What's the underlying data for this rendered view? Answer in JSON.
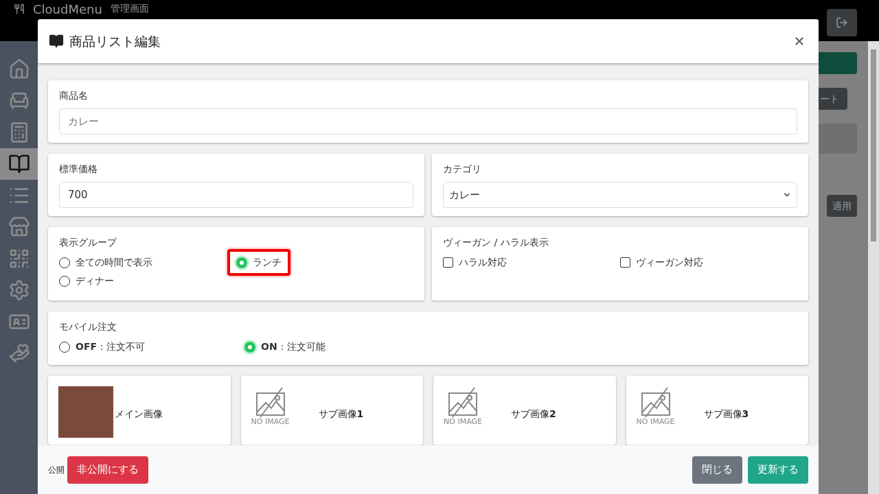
{
  "app": {
    "brand": "CloudMenu",
    "subtitle": "管理画面"
  },
  "sidebar": {
    "items": [
      {
        "selected": false
      },
      {
        "selected": false
      },
      {
        "selected": false
      },
      {
        "selected": true
      },
      {
        "selected": false
      },
      {
        "selected": false
      },
      {
        "selected": false
      },
      {
        "selected": false
      },
      {
        "selected": false
      },
      {
        "selected": false
      }
    ]
  },
  "background": {
    "export_button": "ート",
    "apply_button": "適用"
  },
  "modal": {
    "title": "商品リスト編集",
    "name_field": {
      "label": "商品名",
      "placeholder": "カレー"
    },
    "price_field": {
      "label": "標準価格",
      "value": "700"
    },
    "category_field": {
      "label": "カテゴリ",
      "value": "カレー"
    },
    "display_group": {
      "label": "表示グループ",
      "options": [
        {
          "label": "全ての時間で表示",
          "selected": false,
          "highlighted": false
        },
        {
          "label": "ランチ",
          "selected": true,
          "highlighted": true
        },
        {
          "label": "ディナー",
          "selected": false,
          "highlighted": false
        }
      ]
    },
    "diet": {
      "label": "ヴィーガン / ハラル表示",
      "options": [
        {
          "label": "ハラル対応",
          "checked": false
        },
        {
          "label": "ヴィーガン対応",
          "checked": false
        }
      ]
    },
    "mobile_order": {
      "label": "モバイル注文",
      "options": [
        {
          "label": "**OFF**：注文不可",
          "selected": false
        },
        {
          "label": "**ON**：注文可能",
          "selected": true
        }
      ]
    },
    "images": [
      {
        "kind": "photo",
        "label": "メイン画像"
      },
      {
        "kind": "empty",
        "label": "サブ画像**1**",
        "empty_text": "NO IMAGE"
      },
      {
        "kind": "empty",
        "label": "サブ画像**2**",
        "empty_text": "NO IMAGE"
      },
      {
        "kind": "empty",
        "label": "サブ画像**3**",
        "empty_text": "NO IMAGE"
      }
    ],
    "footer": {
      "status_label": "公開",
      "unpublish_button": "非公開にする",
      "close_button": "閉じる",
      "update_button": "更新する"
    }
  }
}
